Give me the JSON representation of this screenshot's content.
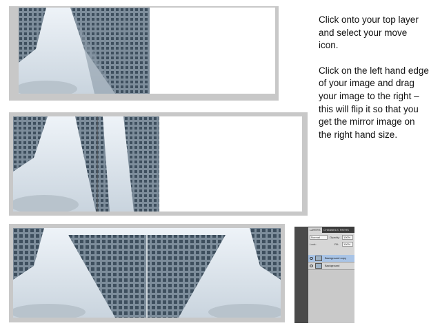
{
  "instructions": {
    "paragraph1": "Click onto your top layer and select your move icon.",
    "paragraph2": "Click on the left hand edge of your image and drag your image to the right – this will flip it so that you get the mirror image on the right hand size."
  },
  "layers_panel": {
    "tabs": [
      "LAYERS",
      "CHANNELS",
      "PATHS"
    ],
    "blend_mode": "Normal",
    "opacity_label": "Opacity:",
    "opacity_value": "100%",
    "lock_label": "Lock:",
    "fill_label": "Fill:",
    "fill_value": "100%",
    "layers": [
      {
        "name": "Background copy",
        "selected": true
      },
      {
        "name": "Background",
        "selected": false
      }
    ]
  },
  "colors": {
    "frame_gray": "#c8c8c8",
    "sky": "#d8e2ec",
    "building": "#6e7f8e",
    "selected_layer": "#a9c4e6"
  }
}
